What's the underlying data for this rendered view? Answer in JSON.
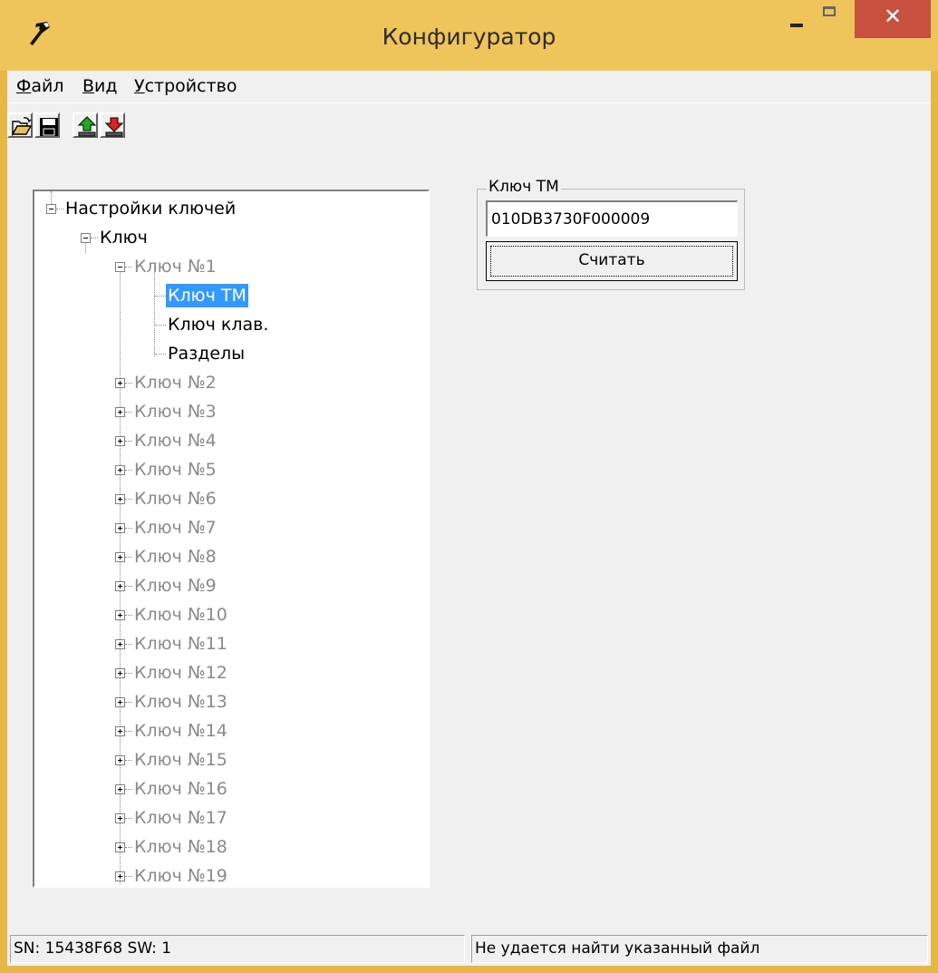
{
  "window": {
    "title": "Конфигуратор",
    "close_glyph": "✕",
    "accent_color": "#efc45a",
    "close_color": "#c7503f"
  },
  "menu": {
    "file": "Файл",
    "view": "Вид",
    "device": "Устройство"
  },
  "toolbar": {
    "open_icon": "folder-open-icon",
    "save_icon": "floppy-disk-icon",
    "upload_icon": "green-up-arrow-icon",
    "download_icon": "red-down-arrow-icon"
  },
  "tree": {
    "root": "Настройки ключей",
    "group": "Ключ",
    "key1": "Ключ №1",
    "key1_children": [
      "Ключ TM",
      "Ключ клав.",
      "Разделы"
    ],
    "selected_child": "Ключ TM",
    "keys": [
      "Ключ №2",
      "Ключ №3",
      "Ключ №4",
      "Ключ №5",
      "Ключ №6",
      "Ключ №7",
      "Ключ №8",
      "Ключ №9",
      "Ключ №10",
      "Ключ №11",
      "Ключ №12",
      "Ключ №13",
      "Ключ №14",
      "Ключ №15",
      "Ключ №16",
      "Ключ №17",
      "Ключ №18",
      "Ключ №19"
    ],
    "selection_color": "#3399ff",
    "disabled_text_color": "#8a8a8a"
  },
  "key_panel": {
    "title": "Ключ TM",
    "value": "010DB3730F000009",
    "read_button": "Считать"
  },
  "status": {
    "left": "SN: 15438F68 SW: 1",
    "right": "Не удается найти указанный файл"
  }
}
